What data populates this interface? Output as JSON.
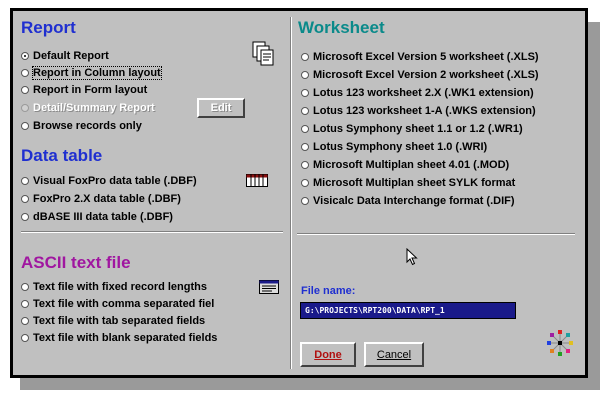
{
  "report": {
    "title": "Report",
    "options": [
      {
        "label": "Default Report",
        "selected": true,
        "disabled": false,
        "focused": false
      },
      {
        "label": "Report in Column layout",
        "selected": false,
        "disabled": false,
        "focused": true
      },
      {
        "label": "Report in Form layout",
        "selected": false,
        "disabled": false,
        "focused": false
      },
      {
        "label": "Detail/Summary Report",
        "selected": false,
        "disabled": true,
        "focused": false
      },
      {
        "label": "Browse records only",
        "selected": false,
        "disabled": false,
        "focused": false
      }
    ],
    "edit_button": "Edit",
    "report_icon": "copy-pages-icon"
  },
  "data_table": {
    "title": "Data table",
    "options": [
      {
        "label": "Visual FoxPro data table (.DBF)"
      },
      {
        "label": "FoxPro 2.X data table (.DBF)"
      },
      {
        "label": "dBASE III data table (.DBF)"
      }
    ],
    "icon": "table-grid-icon"
  },
  "ascii": {
    "title": "ASCII text file",
    "options": [
      {
        "label": "Text file with fixed record lengths"
      },
      {
        "label": "Text file with comma separated fiel"
      },
      {
        "label": "Text file with tab separated fields"
      },
      {
        "label": "Text file with blank separated fields"
      }
    ],
    "icon": "text-file-icon"
  },
  "worksheet": {
    "title": "Worksheet",
    "options": [
      {
        "label": "Microsoft Excel Version 5 worksheet  (.XLS)"
      },
      {
        "label": "Microsoft Excel Version 2 worksheet (.XLS)"
      },
      {
        "label": "Lotus 123 worksheet 2.X (.WK1 extension)"
      },
      {
        "label": "Lotus 123 worksheet 1-A (.WKS extension)"
      },
      {
        "label": "Lotus Symphony sheet 1.1 or 1.2 (.WR1)"
      },
      {
        "label": "Lotus Symphony sheet 1.0 (.WRI)"
      },
      {
        "label": "Microsoft Multiplan sheet 4.01 (.MOD)"
      },
      {
        "label": "Microsoft Multiplan sheet SYLK format"
      },
      {
        "label": "Visicalc Data Interchange format (.DIF)"
      }
    ]
  },
  "file": {
    "label": "File name:",
    "value": "G:\\PROJECTS\\RPT200\\DATA\\RPT_1"
  },
  "buttons": {
    "done": "Done",
    "cancel": "Cancel"
  },
  "colors": {
    "dialog_bg": "#c0c0c0",
    "title_blue": "#1f2fd0",
    "title_teal": "#0a8a8a",
    "title_purple": "#a016a0",
    "field_bg": "#1a1a8a",
    "done_text": "#b01010"
  }
}
